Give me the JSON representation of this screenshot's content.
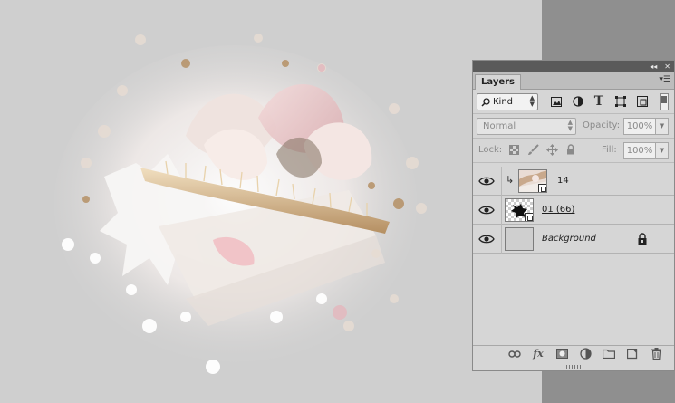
{
  "panel": {
    "tab_label": "Layers",
    "collapse_icon": "double-chevron-left-icon",
    "close_icon": "close-icon",
    "menu_icon": "panel-menu-icon"
  },
  "filter": {
    "kind_label": "Kind",
    "icons": [
      "pixel-filter-icon",
      "adjustment-filter-icon",
      "type-filter-icon",
      "shape-filter-icon",
      "smart-object-filter-icon"
    ]
  },
  "blend": {
    "mode": "Normal",
    "opacity_label": "Opacity:",
    "opacity_value": "100%"
  },
  "lock": {
    "label": "Lock:",
    "fill_label": "Fill:",
    "fill_value": "100%"
  },
  "layers": [
    {
      "name": "14",
      "visible": true,
      "clipped": true,
      "smart_object": true,
      "style": "normal"
    },
    {
      "name": "01 (66)",
      "visible": true,
      "clipped": false,
      "smart_object": true,
      "style": "underlined"
    },
    {
      "name": "Background",
      "visible": true,
      "clipped": false,
      "smart_object": false,
      "style": "italic",
      "locked": true
    }
  ],
  "footer_icons": [
    "link-layers-icon",
    "fx-icon",
    "add-mask-icon",
    "adjustment-layer-icon",
    "new-group-icon",
    "new-layer-icon",
    "trash-icon"
  ],
  "colors": {
    "canvas_bg": "#cfcfcf",
    "panel_bg": "#d6d6d6",
    "dark_strip": "#5a5a5a"
  }
}
